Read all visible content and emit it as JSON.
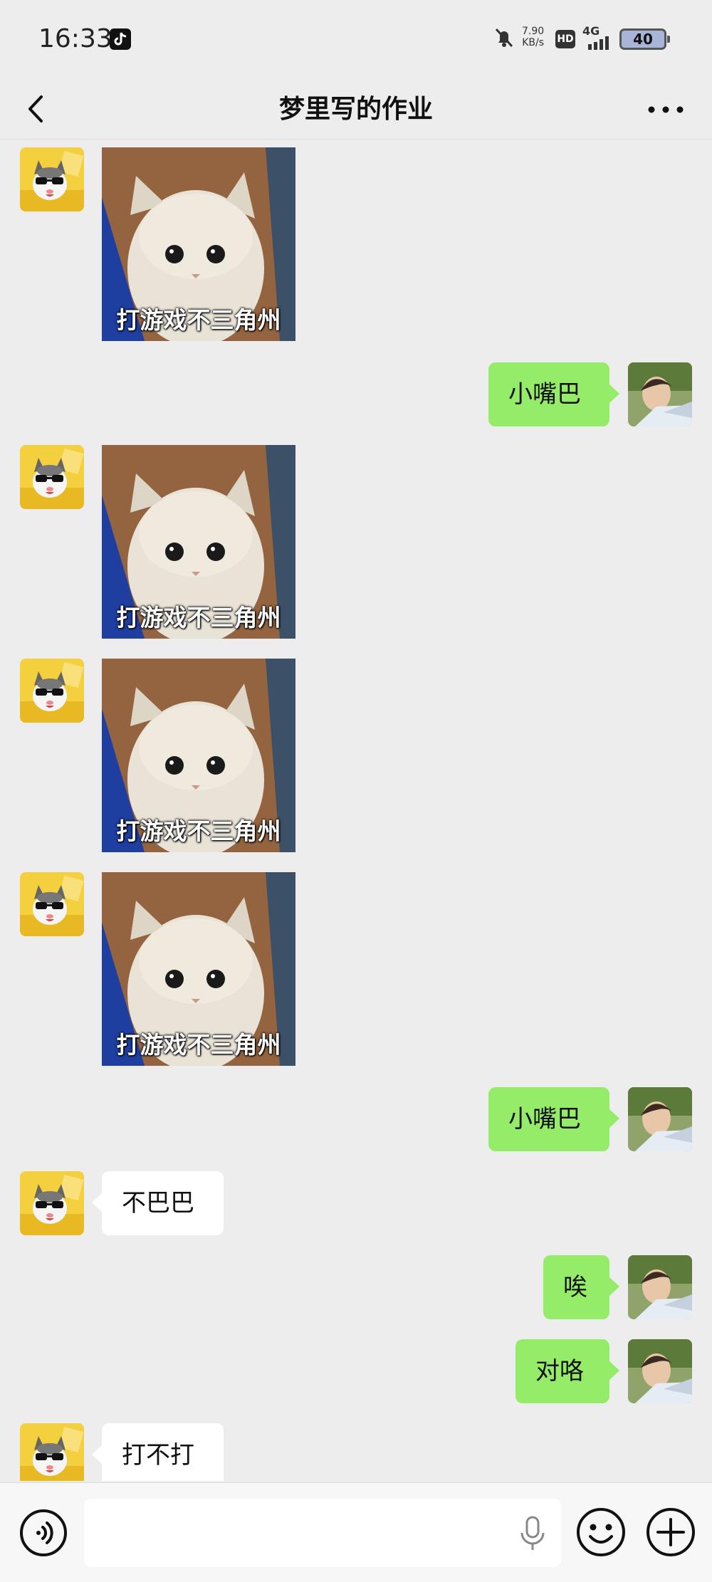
{
  "status_bar": {
    "time": "16:33",
    "net_speed_value": "7.90",
    "net_speed_unit": "KB/s",
    "hd_label": "HD",
    "network_label": "4G",
    "battery_level": "40",
    "icons": [
      "tiktok-icon",
      "mute-bell-icon",
      "signal-icon",
      "battery-icon"
    ]
  },
  "header": {
    "title": "梦里写的作业",
    "back_icon": "chevron-left-icon",
    "more_icon": "more-dots-icon"
  },
  "messages": [
    {
      "side": "left",
      "type": "sticker",
      "caption": "打游戏不三角州"
    },
    {
      "side": "right",
      "type": "text",
      "text": "小嘴巴"
    },
    {
      "side": "left",
      "type": "sticker",
      "caption": "打游戏不三角州"
    },
    {
      "side": "left",
      "type": "sticker",
      "caption": "打游戏不三角州"
    },
    {
      "side": "left",
      "type": "sticker",
      "caption": "打游戏不三角州"
    },
    {
      "side": "right",
      "type": "text",
      "text": "小嘴巴"
    },
    {
      "side": "left",
      "type": "text",
      "text": "不巴巴"
    },
    {
      "side": "right",
      "type": "text",
      "text": "唉"
    },
    {
      "side": "right",
      "type": "text",
      "text": "对咯"
    },
    {
      "side": "left",
      "type": "text",
      "text": "打不打"
    }
  ],
  "input_bar": {
    "input_value": "",
    "icons": [
      "voice-icon",
      "mic-icon",
      "emoji-icon",
      "plus-icon"
    ]
  },
  "colors": {
    "background": "#ededed",
    "bubble_self": "#95ec69",
    "bubble_other": "#ffffff"
  }
}
